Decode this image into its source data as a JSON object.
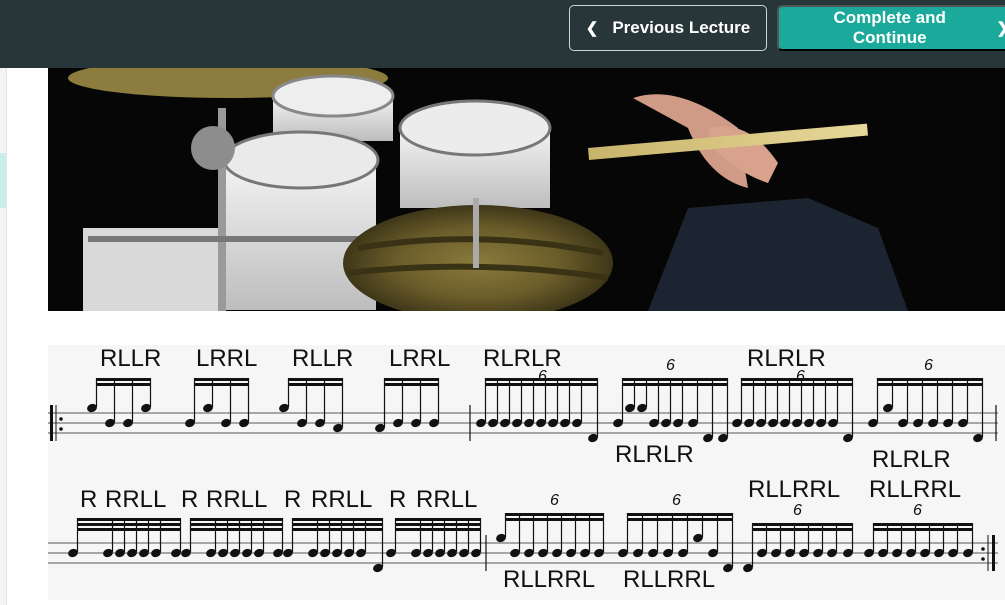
{
  "header": {
    "prev_label": "Previous Lecture",
    "next_label": "Complete and Continue",
    "accent_color": "#1aa99a",
    "bar_color": "#283639"
  },
  "video": {
    "description_icon": "drum-kit-video-frame"
  },
  "sheet_music": {
    "row1_top_labels": [
      "RLLR",
      "LRRL",
      "RLLR",
      "LRRL",
      "RLRLR",
      "RLRLR"
    ],
    "row1_bottom_labels": [
      "RLRLR",
      "RLRLR"
    ],
    "row1_tuplets": [
      "6",
      "6",
      "6",
      "6"
    ],
    "row2_top_labels": [
      "R",
      "RRLL",
      "R",
      "RRLL",
      "R",
      "RRLL",
      "R",
      "RRLL",
      "RLLRRL",
      "RLLRRL"
    ],
    "row2_bottom_labels": [
      "RLLRRL",
      "RLLRRL"
    ],
    "row2_tuplets": [
      "6",
      "6",
      "6",
      "6"
    ]
  }
}
